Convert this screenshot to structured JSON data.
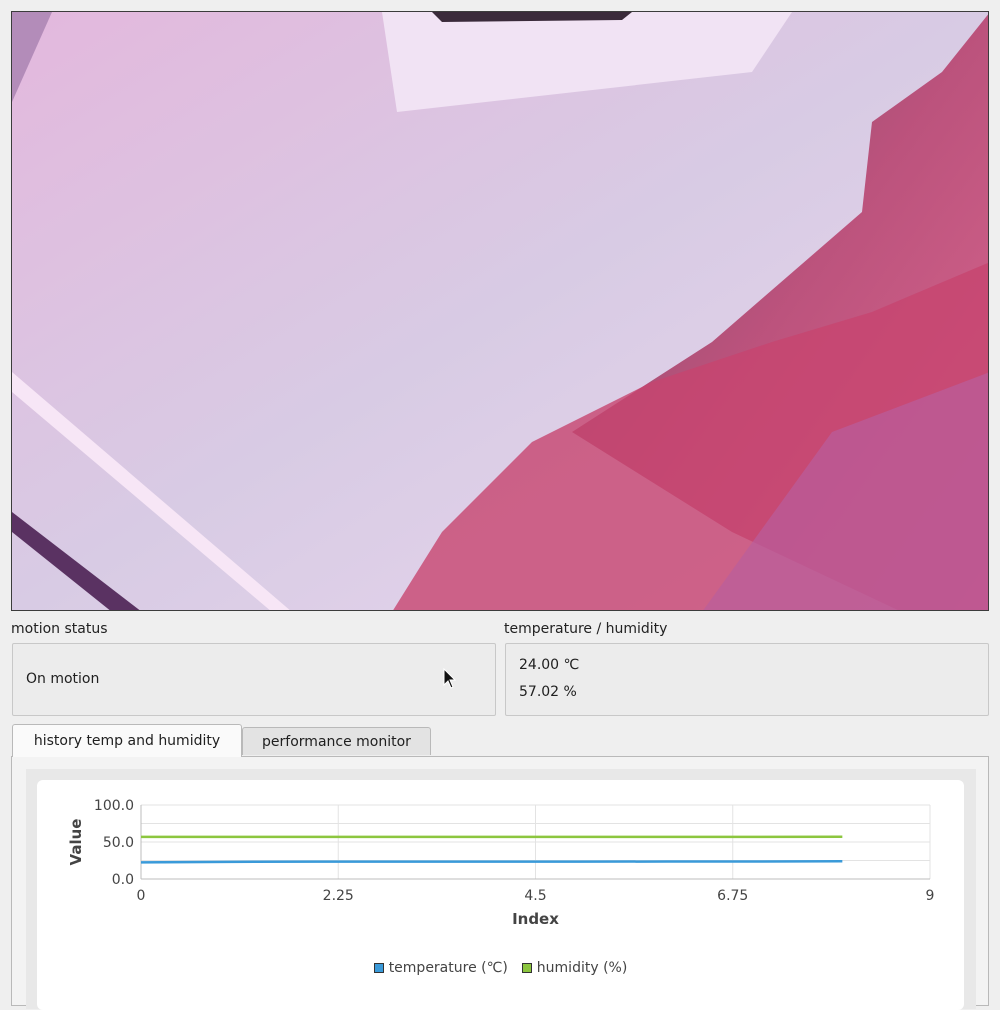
{
  "motion": {
    "title": "motion status",
    "value": "On motion"
  },
  "climate": {
    "title": "temperature / humidity",
    "temperature": "24.00 ℃",
    "humidity": "57.02 %"
  },
  "tabs": [
    {
      "label": "history temp and humidity",
      "active": true
    },
    {
      "label": "performance monitor",
      "active": false
    }
  ],
  "chart_data": {
    "type": "line",
    "xlabel": "Index",
    "ylabel": "Value",
    "xlim": [
      0,
      9
    ],
    "ylim": [
      0,
      100
    ],
    "x_ticks": [
      "0",
      "2.25",
      "4.5",
      "6.75",
      "9"
    ],
    "y_ticks": [
      "0.0",
      "50.0",
      "100.0"
    ],
    "x": [
      0,
      1,
      2,
      3,
      4,
      5,
      6,
      7,
      8
    ],
    "series": [
      {
        "name": "temperature (℃)",
        "color": "#3a9ad9",
        "values": [
          22.5,
          23.2,
          23.4,
          23.5,
          23.5,
          23.5,
          23.6,
          23.6,
          24.0
        ]
      },
      {
        "name": "humidity (%)",
        "color": "#8cc63f",
        "values": [
          57.0,
          57.0,
          57.0,
          57.0,
          57.0,
          57.0,
          57.0,
          57.0,
          57.02
        ]
      }
    ],
    "grid": true,
    "legend": "bottom"
  }
}
